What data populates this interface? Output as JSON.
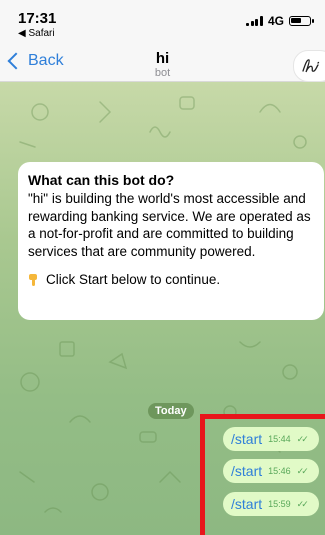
{
  "status_bar": {
    "time": "17:31",
    "back_app": "◀ Safari",
    "network": "4G"
  },
  "nav": {
    "back_label": "Back",
    "title": "hi",
    "subtitle": "bot"
  },
  "card": {
    "title": "What can this bot do?",
    "body": "\"hi\" is building the world's most accessible and rewarding banking service. We are operated as a not-for-profit and are committed to building services that are community powered.",
    "hint": "Click Start below to continue."
  },
  "date_divider": "Today",
  "messages": [
    {
      "text": "/start",
      "time": "15:44"
    },
    {
      "text": "/start",
      "time": "15:46"
    },
    {
      "text": "/start",
      "time": "15:59"
    }
  ],
  "colors": {
    "accent": "#2f7fd9",
    "bubble": "#e1fac7",
    "highlight": "#e8161b"
  }
}
